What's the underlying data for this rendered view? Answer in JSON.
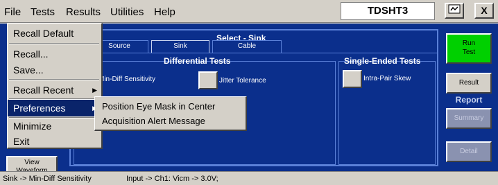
{
  "menubar": {
    "items": [
      "File",
      "Tests",
      "Results",
      "Utilities",
      "Help"
    ],
    "app_title": "TDSHT3",
    "close_label": "X"
  },
  "panel": {
    "select_title": "Select - Sink",
    "tabs": [
      "Source",
      "Sink",
      "Cable"
    ],
    "differential_title": "Differential Tests",
    "single_ended_title": "Single-Ended Tests",
    "diff_options": [
      "Min-Diff Sensitivity",
      "Jitter Tolerance"
    ],
    "se_options": [
      "Intra-Pair Skew"
    ]
  },
  "right": {
    "run_line1": "Run",
    "run_line2": "Test",
    "result": "Result",
    "report": "Report",
    "summary": "Summary",
    "detail": "Detail"
  },
  "left": {
    "view_line1": "View",
    "view_line2": "Waveform"
  },
  "status": {
    "selection": "Sink -> Min-Diff Sensitivity",
    "input": "Input -> Ch1: Vicm -> 3.0V;"
  },
  "file_menu": {
    "items": [
      "Recall Default",
      "Recall...",
      "Save...",
      "Recall Recent",
      "Preferences",
      "Minimize",
      "Exit"
    ],
    "preferences_submenu": [
      "Position Eye Mask in Center",
      "Acquisition Alert Message"
    ]
  }
}
